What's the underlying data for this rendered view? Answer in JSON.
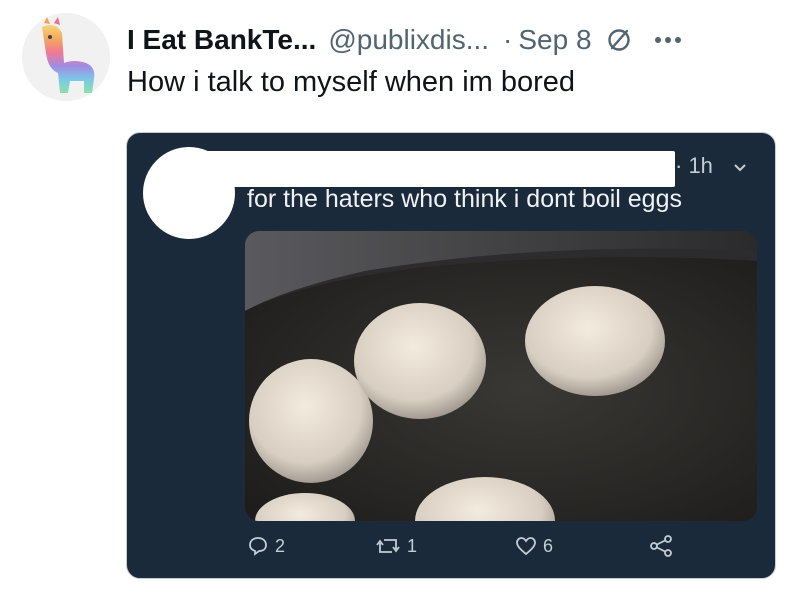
{
  "tweet": {
    "display_name": "I Eat BankTe...",
    "handle": "@publixdis...",
    "separator": "·",
    "date": "Sep 8",
    "text": "How i talk to myself when im bored"
  },
  "embedded_post": {
    "time": "· 1h",
    "text": "for the haters who think i dont boil eggs",
    "reply_count": "2",
    "retweet_count": "1",
    "like_count": "6"
  },
  "colors": {
    "primary_text": "#0f1419",
    "secondary_text": "#536471",
    "embed_background": "#1b2a3a"
  },
  "icons": [
    "verified-badge-icon",
    "more-options-icon",
    "reply-icon",
    "retweet-icon",
    "like-icon",
    "share-icon"
  ]
}
